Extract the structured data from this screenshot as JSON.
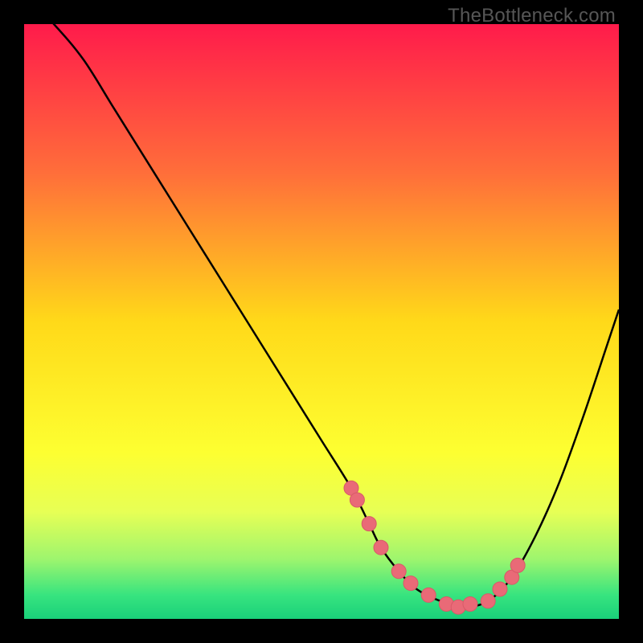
{
  "watermark": "TheBottleneck.com",
  "colors": {
    "frame": "#000000",
    "curve": "#000000",
    "marker_fill": "#e96a77",
    "marker_stroke": "#d85a68",
    "gradient_stops": [
      {
        "offset": 0.0,
        "color": "#ff1b4b"
      },
      {
        "offset": 0.25,
        "color": "#ff6e3a"
      },
      {
        "offset": 0.5,
        "color": "#ffd919"
      },
      {
        "offset": 0.72,
        "color": "#fdff31"
      },
      {
        "offset": 0.82,
        "color": "#e7ff55"
      },
      {
        "offset": 0.9,
        "color": "#9df56e"
      },
      {
        "offset": 0.96,
        "color": "#37e47f"
      },
      {
        "offset": 1.0,
        "color": "#1ad07a"
      }
    ]
  },
  "chart_data": {
    "type": "line",
    "title": "",
    "xlabel": "",
    "ylabel": "",
    "xlim": [
      0,
      100
    ],
    "ylim": [
      0,
      100
    ],
    "series": [
      {
        "name": "bottleneck-curve",
        "x": [
          0,
          5,
          10,
          15,
          20,
          25,
          30,
          35,
          40,
          45,
          50,
          55,
          58,
          60,
          63,
          66,
          70,
          74,
          78,
          82,
          86,
          90,
          94,
          98,
          100
        ],
        "values": [
          105,
          100,
          94,
          86,
          78,
          70,
          62,
          54,
          46,
          38,
          30,
          22,
          16,
          12,
          8,
          5,
          3,
          2,
          3,
          7,
          14,
          23,
          34,
          46,
          52
        ]
      }
    ],
    "markers": {
      "name": "highlighted-points",
      "x": [
        55,
        56,
        58,
        60,
        63,
        65,
        68,
        71,
        73,
        75,
        78,
        80,
        82,
        83
      ],
      "values": [
        22,
        20,
        16,
        12,
        8,
        6,
        4,
        2.5,
        2,
        2.5,
        3,
        5,
        7,
        9
      ]
    }
  }
}
